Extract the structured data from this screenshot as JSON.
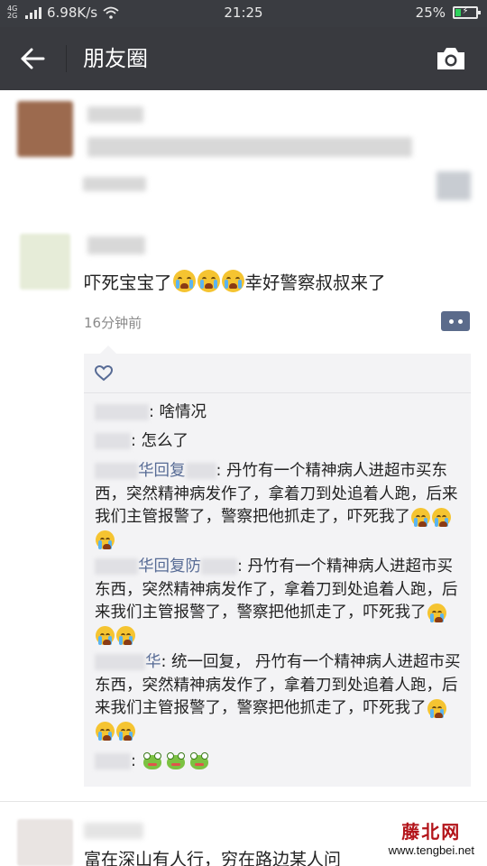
{
  "status_bar": {
    "network_type": "4G 2G",
    "speed": "6.98K/s",
    "time": "21:25",
    "battery": "25%",
    "battery_level": 0.25
  },
  "header": {
    "title": "朋友圈",
    "back_icon": "arrow-left-icon",
    "camera_icon": "camera-icon"
  },
  "post": {
    "text_before": "吓死宝宝了",
    "text_after": "幸好警察叔叔来了",
    "time": "16分钟前",
    "like_icon": "heart-icon",
    "comments": [
      {
        "text": ": 啥情况"
      },
      {
        "text": ": 怎么了"
      },
      {
        "name_suffix": "华回复",
        "text": ": 丹竹有一个精神病人进超市买东西，突然精神病发作了，拿着刀到处追着人跑，后来我们主管报警了，警察把他抓走了，吓死我了"
      },
      {
        "name_suffix": "华回复防",
        "text": ": 丹竹有一个精神病人进超市买东西，突然精神病发作了，拿着刀到处追着人跑，后来我们主管报警了，警察把他抓走了，吓死我了"
      },
      {
        "name_suffix": "华",
        "text": ": 统一回复， 丹竹有一个精神病人进超市买东西，突然精神病发作了，拿着刀到处追着人跑，后来我们主管报警了，警察把他抓走了，吓死我了"
      },
      {
        "text": ":"
      }
    ]
  },
  "next_post": {
    "text": "富在深山有人行，穷在路边某人问"
  },
  "watermark": {
    "logo": "藤北网",
    "url": "www.tengbei.net"
  },
  "colors": {
    "header_bg": "#393a3f",
    "status_bg": "#3a3c41",
    "link_blue": "#576b95",
    "comment_bg": "#f3f3f5"
  }
}
